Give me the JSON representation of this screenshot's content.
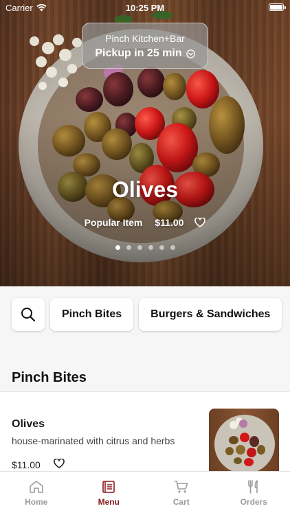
{
  "status_bar": {
    "carrier": "Carrier",
    "time": "10:25 PM"
  },
  "hero": {
    "restaurant": "Pinch Kitchen+Bar",
    "pickup": "Pickup in 25 min",
    "title": "Olives",
    "tag": "Popular Item",
    "price": "$11.00",
    "carousel_pages": 6,
    "carousel_active": 1
  },
  "categories": {
    "search_icon": "search-icon",
    "items": [
      "Pinch Bites",
      "Burgers & Sandwiches"
    ]
  },
  "section": {
    "title": "Pinch Bites"
  },
  "menu_item": {
    "name": "Olives",
    "description": "house-marinated with citrus and herbs",
    "price": "$11.00"
  },
  "tabs": [
    {
      "label": "Home",
      "icon": "home-icon",
      "active": false
    },
    {
      "label": "Menu",
      "icon": "menu-icon",
      "active": true
    },
    {
      "label": "Cart",
      "icon": "cart-icon",
      "active": false
    },
    {
      "label": "Orders",
      "icon": "utensils-icon",
      "active": false
    }
  ],
  "colors": {
    "accent": "#8b1a1a",
    "inactive_tab": "#9b9b9b"
  }
}
